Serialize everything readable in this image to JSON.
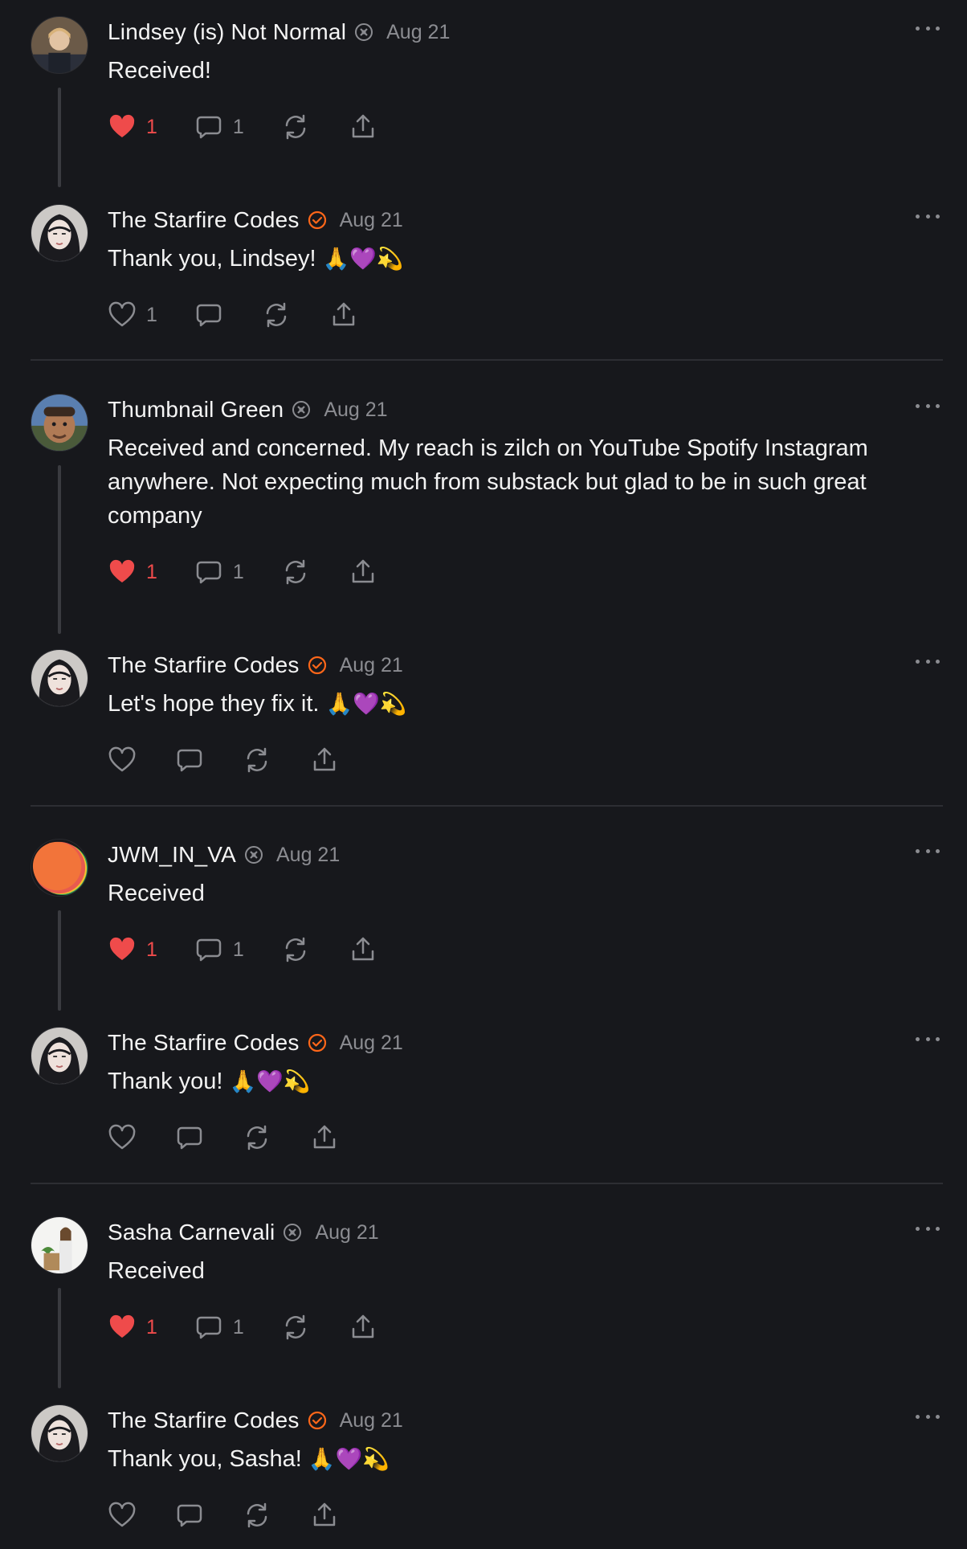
{
  "colors": {
    "background": "#17181c",
    "like": "#ef4b4b",
    "verified": "#ff6719",
    "muted": "#8b8c91"
  },
  "comments": [
    {
      "author": "Lindsey (is) Not Normal",
      "badge": "subscriber-icon",
      "date": "Aug 21",
      "text": "Received!",
      "emoji": "",
      "likes": "1",
      "liked": true,
      "replies": "1"
    },
    {
      "author": "The Starfire Codes",
      "badge": "verified-check-icon",
      "date": "Aug 21",
      "text": "Thank you, Lindsey! ",
      "emoji": "🙏💜💫",
      "likes": "1",
      "liked": false,
      "replies": ""
    },
    {
      "author": "Thumbnail Green",
      "badge": "subscriber-icon",
      "date": "Aug 21",
      "text": "Received and concerned. My reach is zilch on YouTube Spotify Instagram anywhere. Not expecting much from substack but glad to be in such great company",
      "emoji": "",
      "likes": "1",
      "liked": true,
      "replies": "1"
    },
    {
      "author": "The Starfire Codes",
      "badge": "verified-check-icon",
      "date": "Aug 21",
      "text": "Let's hope they fix it. ",
      "emoji": "🙏💜💫",
      "likes": "",
      "liked": false,
      "replies": ""
    },
    {
      "author": "JWM_IN_VA",
      "badge": "subscriber-icon",
      "date": "Aug 21",
      "text": "Received",
      "emoji": "",
      "likes": "1",
      "liked": true,
      "replies": "1"
    },
    {
      "author": "The Starfire Codes",
      "badge": "verified-check-icon",
      "date": "Aug 21",
      "text": "Thank you! ",
      "emoji": "🙏💜💫",
      "likes": "",
      "liked": false,
      "replies": ""
    },
    {
      "author": "Sasha Carnevali",
      "badge": "subscriber-icon",
      "date": "Aug 21",
      "text": "Received",
      "emoji": "",
      "likes": "1",
      "liked": true,
      "replies": "1"
    },
    {
      "author": "The Starfire Codes",
      "badge": "verified-check-icon",
      "date": "Aug 21",
      "text": "Thank you, Sasha! ",
      "emoji": "🙏💜💫",
      "likes": "",
      "liked": false,
      "replies": ""
    }
  ]
}
